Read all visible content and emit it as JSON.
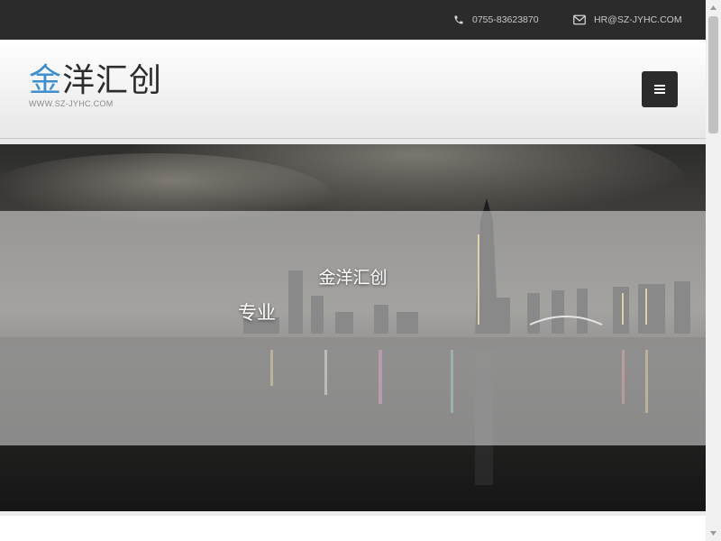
{
  "topbar": {
    "phone": {
      "icon": "phone-icon",
      "text": "0755-83623870"
    },
    "email": {
      "icon": "envelope-icon",
      "text": "HR@SZ-JYHC.COM"
    }
  },
  "header": {
    "logo_accent": "金",
    "logo_rest": "洋汇创",
    "logo_sub": "WWW.SZ-JYHC.COM",
    "menu_icon": "hamburger-icon"
  },
  "hero": {
    "title": "金洋汇创",
    "subtitle": "专业  "
  },
  "colors": {
    "topbar_bg": "#2b2b2b",
    "logo_accent": "#3d8fd0",
    "logo_text": "#2c2c2c",
    "menu_button_bg": "#2b2b2b"
  }
}
